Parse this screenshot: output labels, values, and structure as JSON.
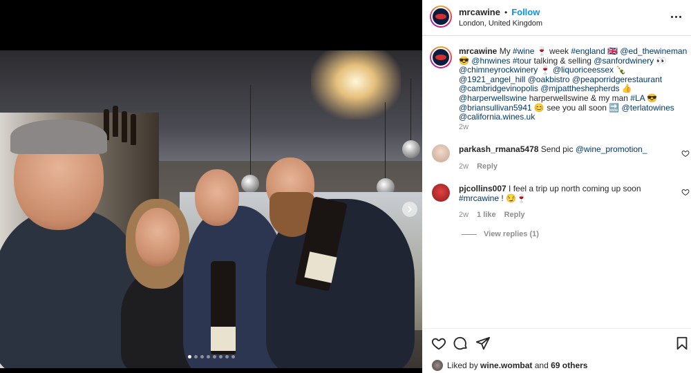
{
  "post": {
    "username": "mrcawine",
    "follow_label": "Follow",
    "separator": "•",
    "location": "London, United Kingdom",
    "image_carousel": {
      "total_slides": 8,
      "active_slide": 1
    }
  },
  "caption": {
    "username": "mrcawine",
    "segments": [
      {
        "t": "My ",
        "link": false
      },
      {
        "t": "#wine",
        "link": true
      },
      {
        "t": " 🍷 week ",
        "link": false
      },
      {
        "t": "#england",
        "link": true
      },
      {
        "t": " 🇬🇧 ",
        "link": false
      },
      {
        "t": "@ed_thewineman",
        "link": true
      },
      {
        "t": " 😎 ",
        "link": false
      },
      {
        "t": "@hnwines",
        "link": true
      },
      {
        "t": " ",
        "link": false
      },
      {
        "t": "#tour",
        "link": true
      },
      {
        "t": " talking & selling ",
        "link": false
      },
      {
        "t": "@sanfordwinery",
        "link": true
      },
      {
        "t": " 👀 ",
        "link": false
      },
      {
        "t": "@chimneyrockwinery",
        "link": true
      },
      {
        "t": " 🍷 ",
        "link": false
      },
      {
        "t": "@liquoriceessex",
        "link": true
      },
      {
        "t": " 🍾 ",
        "link": false
      },
      {
        "t": "@1921_angel_hill",
        "link": true
      },
      {
        "t": " ",
        "link": false
      },
      {
        "t": "@oakbistro",
        "link": true
      },
      {
        "t": " ",
        "link": false
      },
      {
        "t": "@peaporridgerestaurant",
        "link": true
      },
      {
        "t": " ",
        "link": false
      },
      {
        "t": "@cambridgevinopolis",
        "link": true
      },
      {
        "t": " ",
        "link": false
      },
      {
        "t": "@mjpattheshepherds",
        "link": true
      },
      {
        "t": " 👍",
        "link": false
      },
      {
        "t": "@harperwellswine",
        "link": true
      },
      {
        "t": " harperwellswine & my man ",
        "link": false
      },
      {
        "t": "#LA",
        "link": true
      },
      {
        "t": " 😎 ",
        "link": false
      },
      {
        "t": "@briansullivan5941",
        "link": true
      },
      {
        "t": " 😊 see you all soon 🔜 ",
        "link": false
      },
      {
        "t": "@terlatowines",
        "link": true
      },
      {
        "t": " ",
        "link": false
      },
      {
        "t": "@california.wines.uk",
        "link": true
      }
    ],
    "time": "2w"
  },
  "comments": [
    {
      "username": "parkash_rmana5478",
      "text_plain": "Send pic ",
      "text_link": "@wine_promotion_",
      "time": "2w",
      "reply_label": "Reply"
    },
    {
      "username": "pjcollins007",
      "text_plain": "I feel a trip up north coming up soon ",
      "text_link": "#mrcawine",
      "text_tail": " ! 😏🍷",
      "time": "2w",
      "likes": "1 like",
      "reply_label": "Reply",
      "view_replies": "View replies (1)"
    }
  ],
  "likes": {
    "prefix": "Liked by",
    "user": "wine.wombat",
    "middle": "and",
    "others": "69 others"
  },
  "icons": [
    "heart-icon",
    "comment-icon",
    "share-icon",
    "bookmark-icon",
    "more-options-icon",
    "next-slide-icon"
  ],
  "colors": {
    "link": "#00376b",
    "follow": "#0095f6",
    "muted": "#8e8e8e",
    "text": "#262626"
  }
}
